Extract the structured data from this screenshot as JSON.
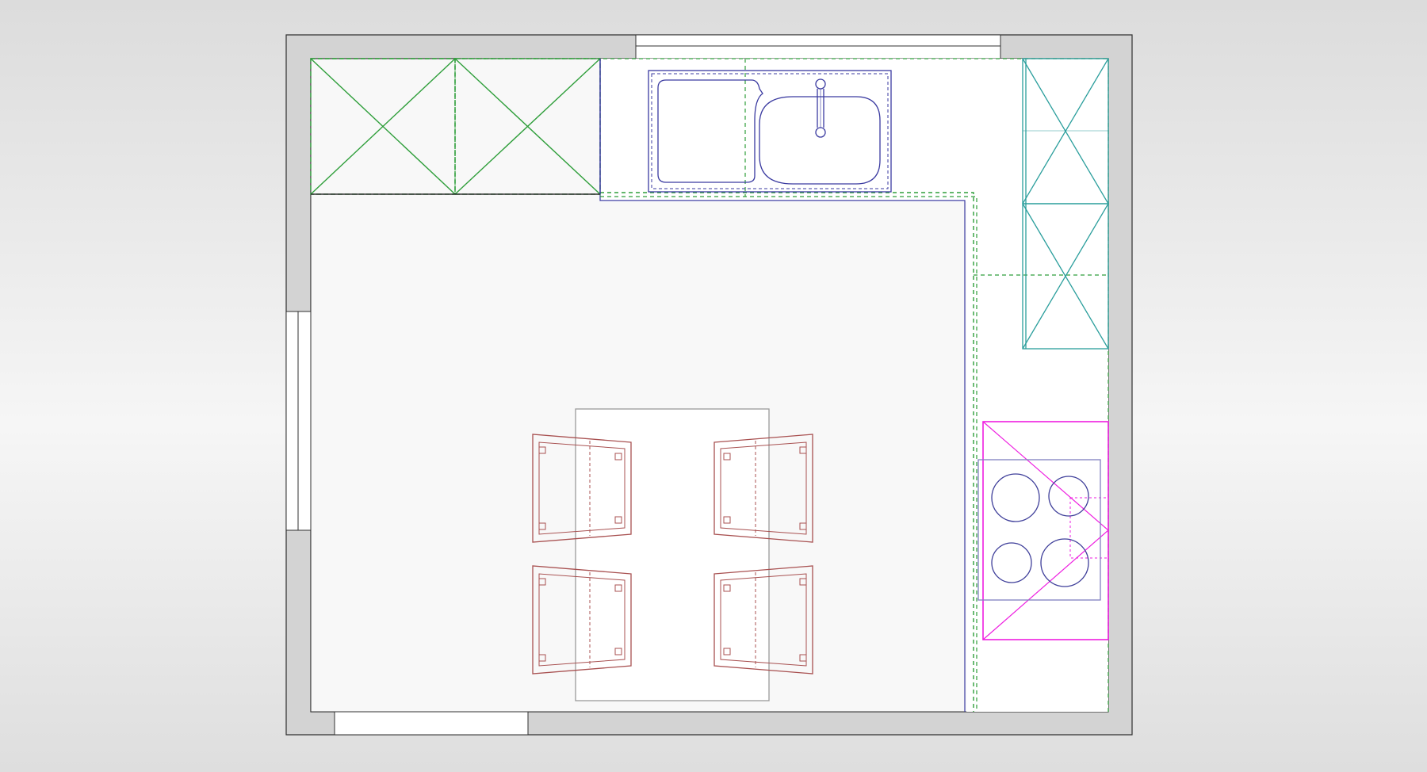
{
  "plan": {
    "colors": {
      "background": "#ececec",
      "wall": "#d3d3d3",
      "wall_line": "#303030",
      "floor": "#f8f8f8",
      "wall_cabinets": "#2e9e3a",
      "tall_unit": "#2a9e9c",
      "sink": "#3a3aa0",
      "worktop_dashes": "#2e9e3a",
      "hob_unit": "#ee1ee0",
      "hob": "#3f3f9a",
      "chairs": "#a85050",
      "table": "#9a9a9a"
    },
    "items": [
      {
        "name": "wall-cabinet",
        "count": 2
      },
      {
        "name": "sink",
        "bowls": 2,
        "faucet": 1
      },
      {
        "name": "tall-unit",
        "count": 2
      },
      {
        "name": "hob",
        "burners": 4
      },
      {
        "name": "dining-table",
        "count": 1
      },
      {
        "name": "chair",
        "count": 4
      }
    ],
    "openings": [
      "window-top",
      "window-left",
      "door-bottom"
    ]
  }
}
